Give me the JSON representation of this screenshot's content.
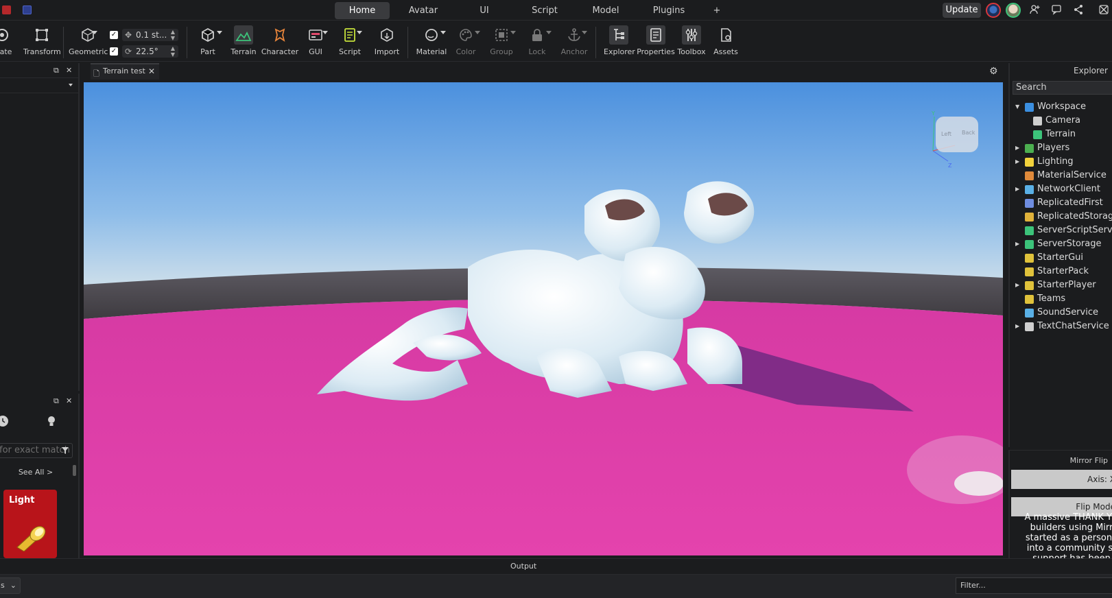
{
  "top_tabs": {
    "home": "Home",
    "avatar": "Avatar",
    "ui": "UI",
    "script": "Script",
    "model": "Model",
    "plugins": "Plugins",
    "add": "+"
  },
  "header": {
    "update_label": "Update"
  },
  "ribbon": {
    "rotate": "otate",
    "transform": "Transform",
    "geometric": "Geometric",
    "move_snap": "0.1 st...",
    "rotate_snap": "22.5°",
    "part": "Part",
    "terrain": "Terrain",
    "character": "Character",
    "gui": "GUI",
    "script": "Script",
    "import": "Import",
    "material": "Material",
    "color": "Color",
    "group": "Group",
    "lock": "Lock",
    "anchor": "Anchor",
    "explorer": "Explorer",
    "properties": "Properties",
    "toolbox": "Toolbox",
    "assets": "Assets"
  },
  "document_tab": {
    "title": "Terrain test"
  },
  "left_panel": {
    "search_placeholder": "for exact match",
    "see_all": "See All >",
    "card_label": "Light"
  },
  "explorer": {
    "title": "Explorer",
    "search_placeholder": "Search",
    "items": [
      {
        "label": "Workspace",
        "icon": "globe-icon",
        "expanded": true,
        "indent": 0,
        "color": "#3b8fe0"
      },
      {
        "label": "Camera",
        "icon": "camera-icon",
        "indent": 1,
        "color": "#cfcfcf"
      },
      {
        "label": "Terrain",
        "icon": "terrain-icon",
        "indent": 1,
        "color": "#3cc37a"
      },
      {
        "label": "Players",
        "icon": "players-icon",
        "arrow": true,
        "indent": 0,
        "color": "#4caf50"
      },
      {
        "label": "Lighting",
        "icon": "lightbulb-icon",
        "arrow": true,
        "indent": 0,
        "color": "#f2d23c"
      },
      {
        "label": "MaterialService",
        "icon": "material-service-icon",
        "indent": 0,
        "color": "#e08a3b"
      },
      {
        "label": "NetworkClient",
        "icon": "network-icon",
        "arrow": true,
        "indent": 0,
        "color": "#5ab0e6"
      },
      {
        "label": "ReplicatedFirst",
        "icon": "replicated-first-icon",
        "indent": 0,
        "color": "#6f8de0"
      },
      {
        "label": "ReplicatedStorage",
        "icon": "replicated-storage-icon",
        "indent": 0,
        "color": "#e0b23b"
      },
      {
        "label": "ServerScriptService",
        "icon": "server-script-icon",
        "indent": 0,
        "color": "#3cc37a"
      },
      {
        "label": "ServerStorage",
        "icon": "server-storage-icon",
        "arrow": true,
        "indent": 0,
        "color": "#3cc37a"
      },
      {
        "label": "StarterGui",
        "icon": "starter-gui-icon",
        "indent": 0,
        "color": "#e0c23b"
      },
      {
        "label": "StarterPack",
        "icon": "starter-pack-icon",
        "indent": 0,
        "color": "#e0c23b"
      },
      {
        "label": "StarterPlayer",
        "icon": "starter-player-icon",
        "arrow": true,
        "indent": 0,
        "color": "#e0c23b"
      },
      {
        "label": "Teams",
        "icon": "teams-icon",
        "indent": 0,
        "color": "#e0c23b"
      },
      {
        "label": "SoundService",
        "icon": "sound-icon",
        "indent": 0,
        "color": "#5ab0e6"
      },
      {
        "label": "TextChatService",
        "icon": "text-chat-icon",
        "arrow": true,
        "indent": 0,
        "color": "#cfcfcf"
      }
    ]
  },
  "mirror_flip": {
    "title": "Mirror Flip",
    "axis_label": "Axis: X",
    "flip_mode_label": "Flip Mode",
    "description": "A massive THANK YO\nbuilders using Mirr\nstarted as a persona\ninto a community st\nsupport has been"
  },
  "output": {
    "title": "Output",
    "select_value": "s",
    "filter_placeholder": "Filter..."
  },
  "colors": {
    "floor_pink": "#e43fae",
    "sky_blue": "#4b90de",
    "card_red": "#b8141a"
  }
}
